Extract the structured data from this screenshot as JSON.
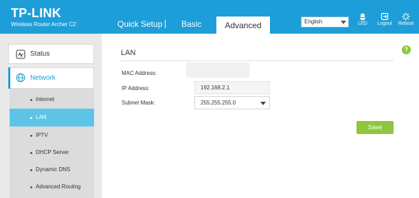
{
  "brand": {
    "logo": "TP-LINK",
    "model": "Wireless Router Archer C2"
  },
  "nav": {
    "tabs": [
      {
        "label": "Quick Setup"
      },
      {
        "label": "Basic"
      },
      {
        "label": "Advanced"
      }
    ],
    "active_tab": "Advanced"
  },
  "header": {
    "language": "English",
    "buttons": [
      {
        "label": "LED",
        "icon": "led-icon"
      },
      {
        "label": "Logout",
        "icon": "logout-icon"
      },
      {
        "label": "Reboot",
        "icon": "reboot-icon"
      }
    ]
  },
  "sidebar": {
    "items": [
      {
        "label": "Status",
        "icon": "status-icon"
      },
      {
        "label": "Network",
        "icon": "globe-icon"
      }
    ],
    "submenu": [
      {
        "label": "Internet"
      },
      {
        "label": "LAN"
      },
      {
        "label": "IPTV"
      },
      {
        "label": "DHCP Server"
      },
      {
        "label": "Dynamic DNS"
      },
      {
        "label": "Advanced Routing"
      }
    ],
    "active_submenu": "LAN"
  },
  "lan": {
    "title": "LAN",
    "mac_label": "MAC Address:",
    "mac_value": "",
    "ip_label": "IP Address:",
    "ip_value": "192.168.2.1",
    "mask_label": "Subnet Mask:",
    "mask_value": "255.255.255.0",
    "save_label": "Save",
    "help_label": "?"
  },
  "colors": {
    "brand_blue": "#1e9ed8",
    "active_submenu": "#5ec4e7",
    "accent_green": "#8dc63f"
  }
}
